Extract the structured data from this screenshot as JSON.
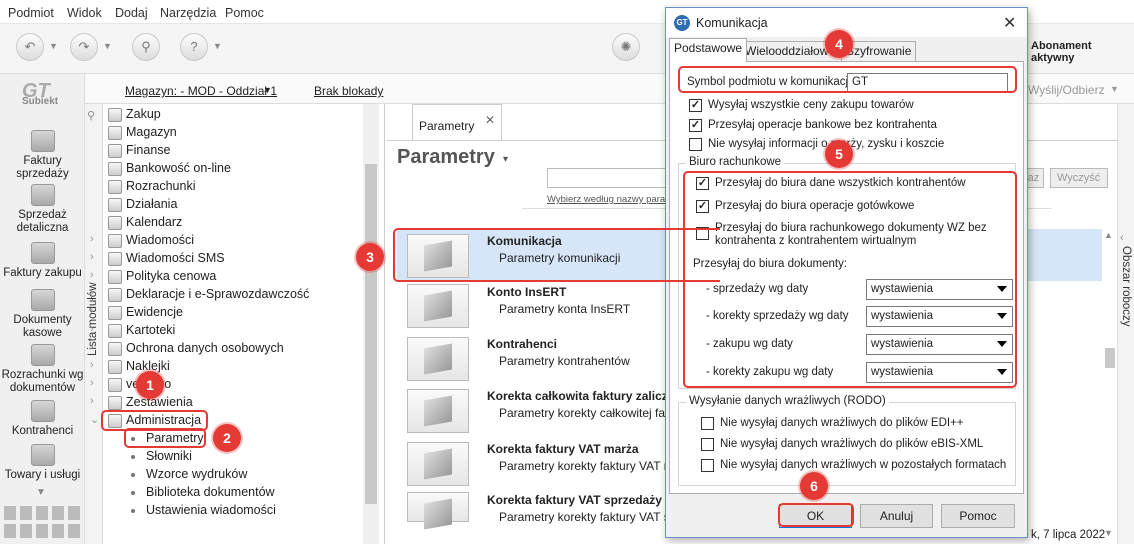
{
  "menu": [
    "Podmiot",
    "Widok",
    "Dodaj",
    "Narzędzia",
    "Pomoc"
  ],
  "toolbar": {
    "subscription": "Abonament aktywny",
    "send_receive": "Wyślij/Odbierz"
  },
  "logo": "Subiekt",
  "left_nav": [
    "Faktury sprzedaży",
    "Sprzedaż detaliczna",
    "Faktury zakupu",
    "Dokumenty kasowe",
    "Rozrachunki wg dokumentów",
    "Kontrahenci",
    "Towary i usługi"
  ],
  "subbar": {
    "magazyn": "Magazyn: - MOD - Oddział 1",
    "blokada": "Brak blokady"
  },
  "modules_tab": "Lista modułów",
  "tree": [
    "Zakup",
    "Magazyn",
    "Finanse",
    "Bankowość on-line",
    "Rozrachunki",
    "Działania",
    "Kalendarz",
    "Wiadomości",
    "Wiadomości SMS",
    "Polityka cenowa",
    "Deklaracje i e-Sprawozdawczość",
    "Ewidencje",
    "Kartoteki",
    "Ochrona danych osobowych",
    "Naklejki",
    "vendero",
    "Zestawienia",
    "Administracja"
  ],
  "subtree": [
    "Parametry",
    "Słowniki",
    "Wzorce wydruków",
    "Biblioteka dokumentów",
    "Ustawienia wiadomości"
  ],
  "main": {
    "tab": "Parametry",
    "title": "Parametry",
    "search_hint": "Wybierz według nazwy param",
    "btn_filter": "raz",
    "btn_clear": "Wyczyść",
    "rows": [
      {
        "title": "Komunikacja",
        "sub": "Parametry komunikacji"
      },
      {
        "title": "Konto InsERT",
        "sub": "Parametry konta InsERT"
      },
      {
        "title": "Kontrahenci",
        "sub": "Parametry kontrahentów"
      },
      {
        "title": "Korekta całkowita faktury zaliczkow",
        "sub": "Parametry korekty całkowitej fak"
      },
      {
        "title": "Korekta faktury VAT marża",
        "sub": "Parametry korekty faktury VAT m"
      },
      {
        "title": "Korekta faktury VAT sprzedaży",
        "sub": "Parametry korekty faktury VAT sp"
      }
    ],
    "statusdate": "k, 7 lipca 2022"
  },
  "right_panel": "Obszar roboczy",
  "dialog": {
    "title": "Komunikacja",
    "tabs": [
      "Podstawowe",
      "Wielooddziałowość",
      "Szyfrowanie"
    ],
    "symbol_label": "Symbol podmiotu w komunikacji:",
    "symbol_value": "GT",
    "checks": [
      {
        "label": "Wysyłaj wszystkie ceny zakupu towarów",
        "checked": true
      },
      {
        "label": "Przesyłaj operacje bankowe bez kontrahenta",
        "checked": true
      },
      {
        "label": "Nie wysyłaj informacji o marży, zysku i koszcie",
        "checked": false
      }
    ],
    "biuro_label": "Biuro rachunkowe",
    "biuro_checks": [
      {
        "label": "Przesyłaj do biura dane wszystkich kontrahentów",
        "checked": true
      },
      {
        "label": "Przesyłaj do biura operacje gotówkowe",
        "checked": true
      },
      {
        "label": "Przesyłaj do biura rachunkowego dokumenty WZ bez",
        "label2": "kontrahenta z kontrahentem wirtualnym",
        "checked": false
      }
    ],
    "docs_label": "Przesyłaj do biura dokumenty:",
    "docs": [
      {
        "label": "- sprzedaży wg daty",
        "value": "wystawienia"
      },
      {
        "label": "- korekty sprzedaży wg daty",
        "value": "wystawienia"
      },
      {
        "label": "- zakupu wg daty",
        "value": "wystawienia"
      },
      {
        "label": "- korekty zakupu wg daty",
        "value": "wystawienia"
      }
    ],
    "rodo_label": "Wysyłanie danych wrażliwych (RODO)",
    "rodo_checks": [
      {
        "label": "Nie wysyłaj danych wrażliwych do plików EDI++",
        "checked": false
      },
      {
        "label": "Nie wysyłaj danych wrażliwych do plików eBIS-XML",
        "checked": false
      },
      {
        "label": "Nie wysyłaj danych wrażliwych w pozostałych formatach",
        "checked": false
      }
    ],
    "ok": "OK",
    "cancel": "Anuluj",
    "help": "Pomoc"
  },
  "badges": [
    "1",
    "2",
    "3",
    "4",
    "5",
    "6"
  ]
}
